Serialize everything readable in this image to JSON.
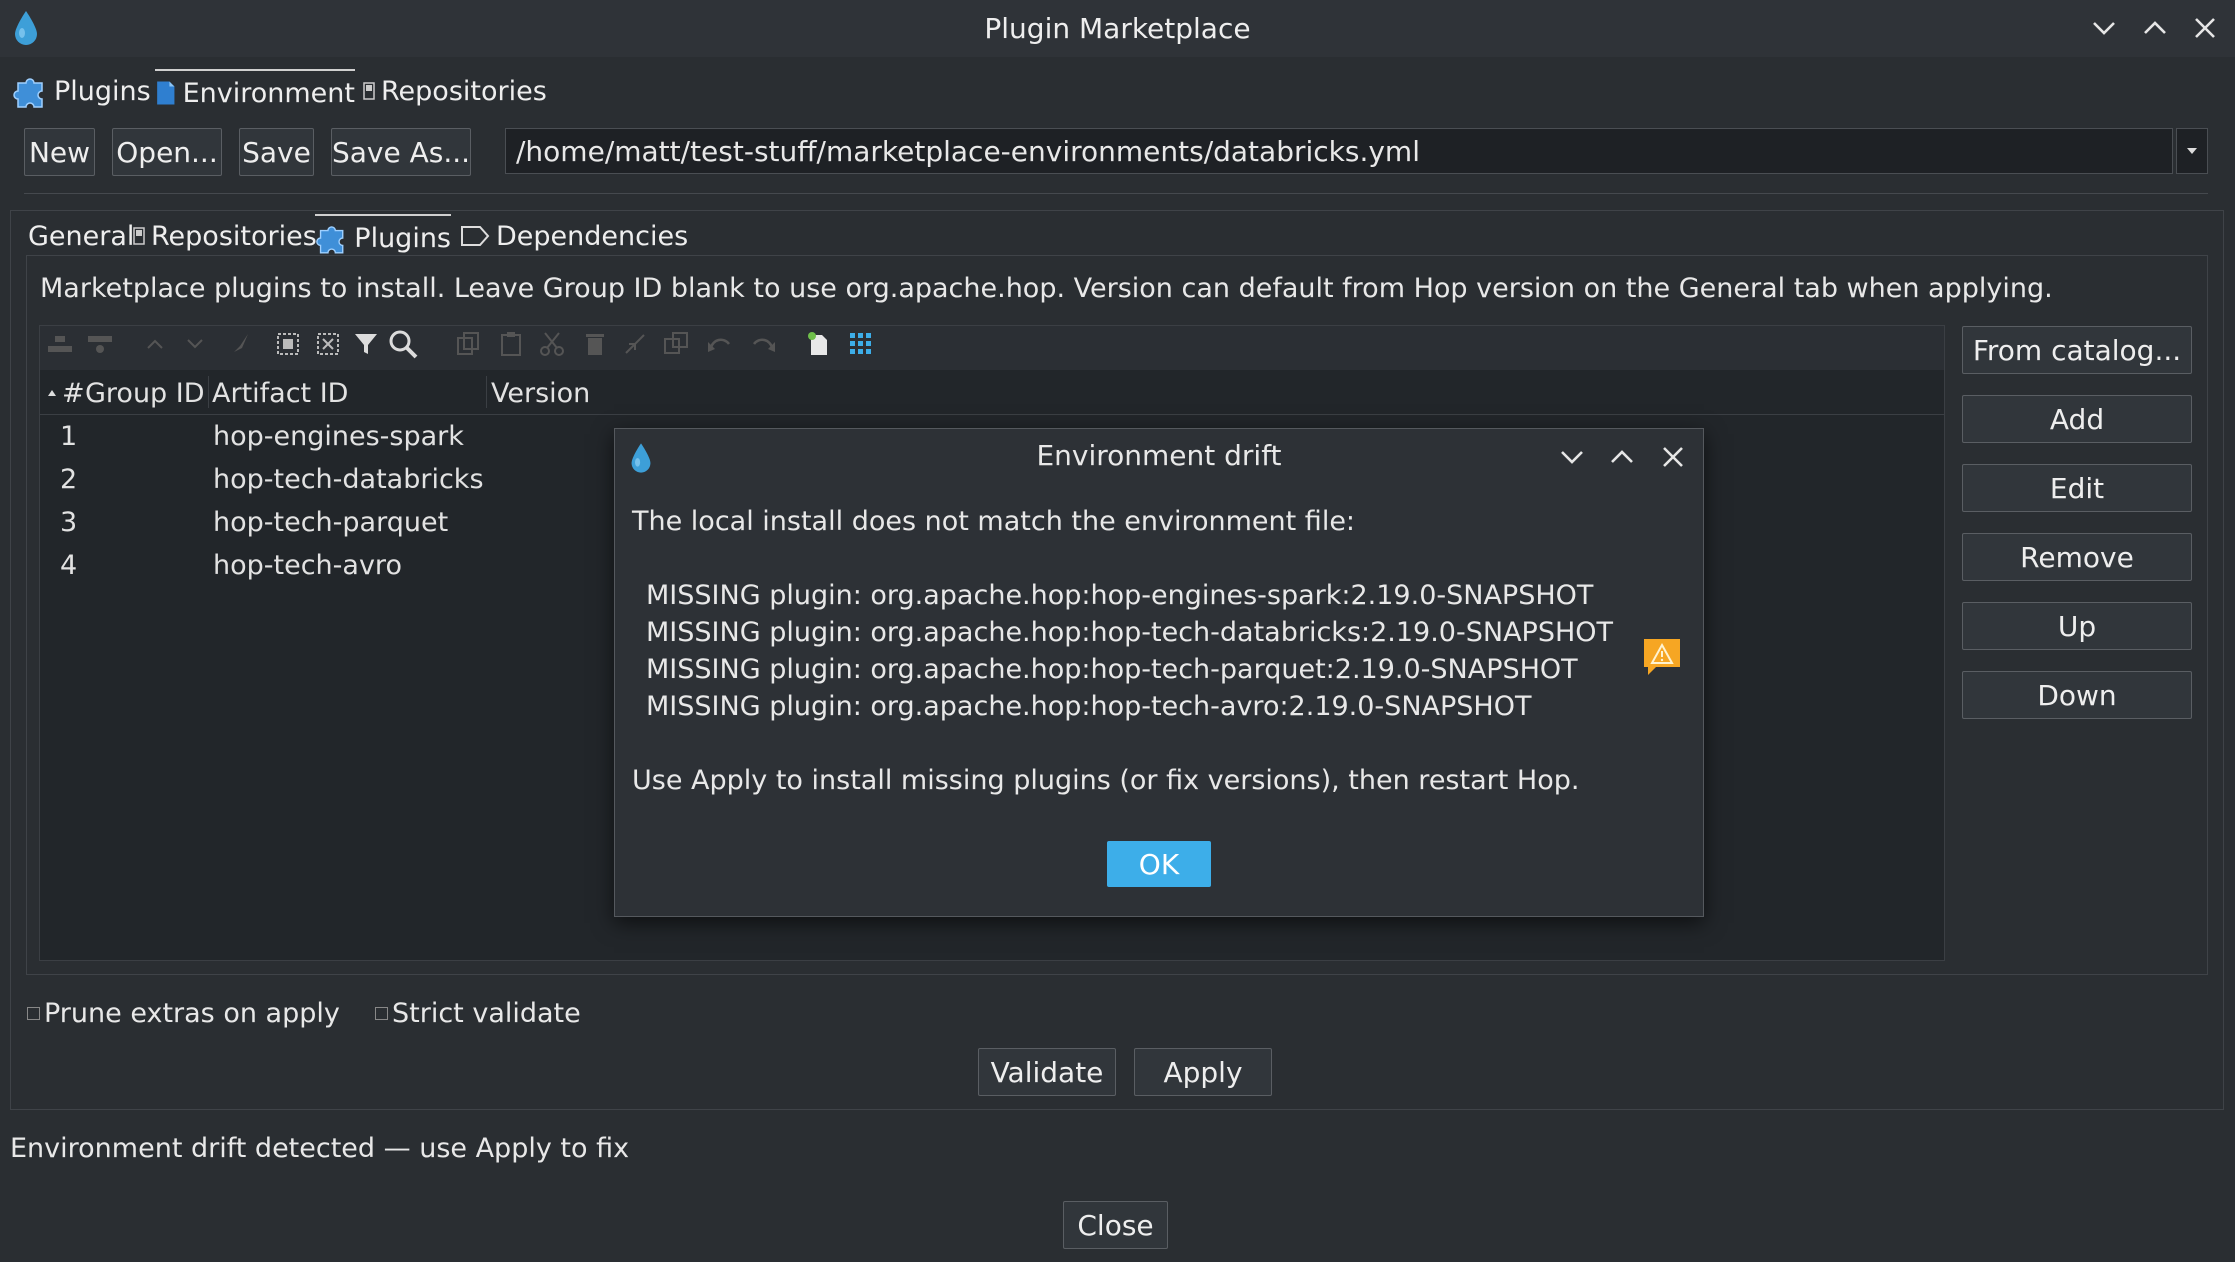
{
  "window": {
    "title": "Plugin Marketplace"
  },
  "top_tabs": [
    {
      "label": "Plugins",
      "icon": "puzzle-icon"
    },
    {
      "label": "Environment",
      "icon": "document-icon"
    },
    {
      "label": "Repositories",
      "icon": "repository-icon"
    }
  ],
  "toolbar": {
    "new_label": "New",
    "open_label": "Open...",
    "save_label": "Save",
    "save_as_label": "Save As...",
    "file_path": "/home/matt/test-stuff/marketplace-environments/databricks.yml"
  },
  "inner_tabs": [
    {
      "label": "General"
    },
    {
      "label": "Repositories",
      "icon": "repository-icon"
    },
    {
      "label": "Plugins",
      "icon": "puzzle-icon"
    },
    {
      "label": "Dependencies",
      "icon": "tag-icon"
    }
  ],
  "description": "Marketplace plugins to install. Leave Group ID blank to use org.apache.hop. Version can default from Hop version on the General tab when applying.",
  "table": {
    "columns": [
      "#",
      "Group ID",
      "Artifact ID",
      "Version"
    ],
    "rows": [
      {
        "num": "1",
        "group": "",
        "artifact": "hop-engines-spark",
        "version": ""
      },
      {
        "num": "2",
        "group": "",
        "artifact": "hop-tech-databricks",
        "version": ""
      },
      {
        "num": "3",
        "group": "",
        "artifact": "hop-tech-parquet",
        "version": ""
      },
      {
        "num": "4",
        "group": "",
        "artifact": "hop-tech-avro",
        "version": ""
      }
    ]
  },
  "side_buttons": {
    "from_catalog": "From catalog...",
    "add": "Add",
    "edit": "Edit",
    "remove": "Remove",
    "up": "Up",
    "down": "Down"
  },
  "options": {
    "prune_label": "Prune extras on apply",
    "strict_label": "Strict validate"
  },
  "actions": {
    "validate": "Validate",
    "apply": "Apply"
  },
  "status": "Environment drift detected — use Apply to fix",
  "close_label": "Close",
  "dialog": {
    "title": "Environment drift",
    "intro": "The local install does not match the environment file:",
    "lines": [
      "MISSING plugin: org.apache.hop:hop-engines-spark:2.19.0-SNAPSHOT",
      "MISSING plugin: org.apache.hop:hop-tech-databricks:2.19.0-SNAPSHOT",
      "MISSING plugin: org.apache.hop:hop-tech-parquet:2.19.0-SNAPSHOT",
      "MISSING plugin: org.apache.hop:hop-tech-avro:2.19.0-SNAPSHOT"
    ],
    "footer": "Use Apply to install missing plugins (or fix versions), then restart Hop.",
    "ok_label": "OK"
  },
  "colors": {
    "accent": "#3daee9",
    "warning": "#f6a623",
    "background": "#2a2e32"
  }
}
